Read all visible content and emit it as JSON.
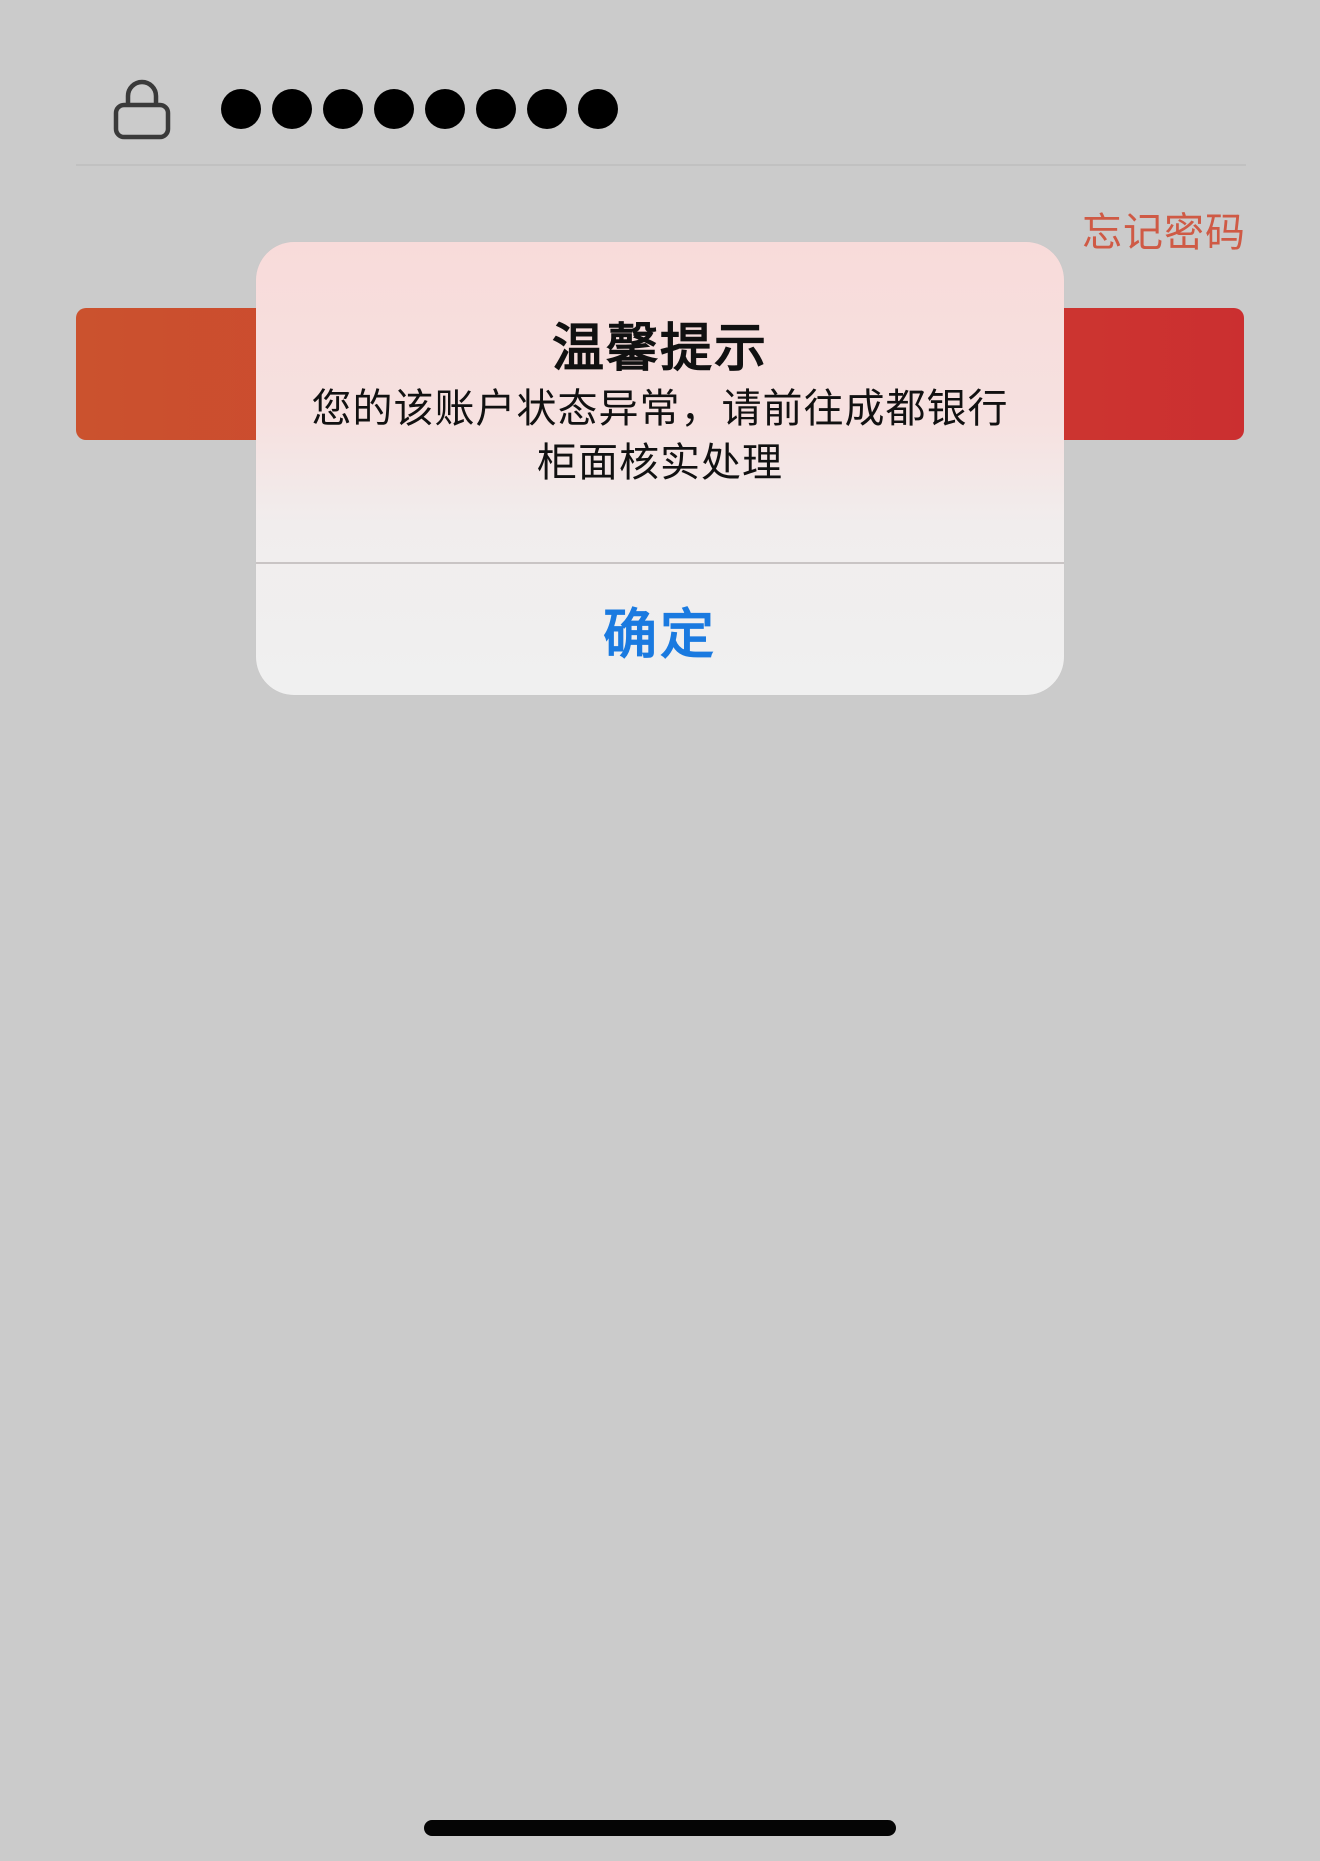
{
  "password_field": {
    "masked_value": "●●●●●●●●●",
    "dot_count": 8
  },
  "forgot_password": {
    "label": "忘记密码"
  },
  "login_button": {
    "label": ""
  },
  "dialog": {
    "title": "温馨提示",
    "message": "您的该账户状态异常，请前往成都银行柜面核实处理",
    "confirm_label": "确定"
  },
  "colors": {
    "brand_red": "#cd3a31",
    "link_red": "#cf5a45",
    "confirm_blue": "#1a7ae0",
    "background_gray": "#cbcbcb"
  },
  "icons": {
    "lock": "lock-icon"
  }
}
